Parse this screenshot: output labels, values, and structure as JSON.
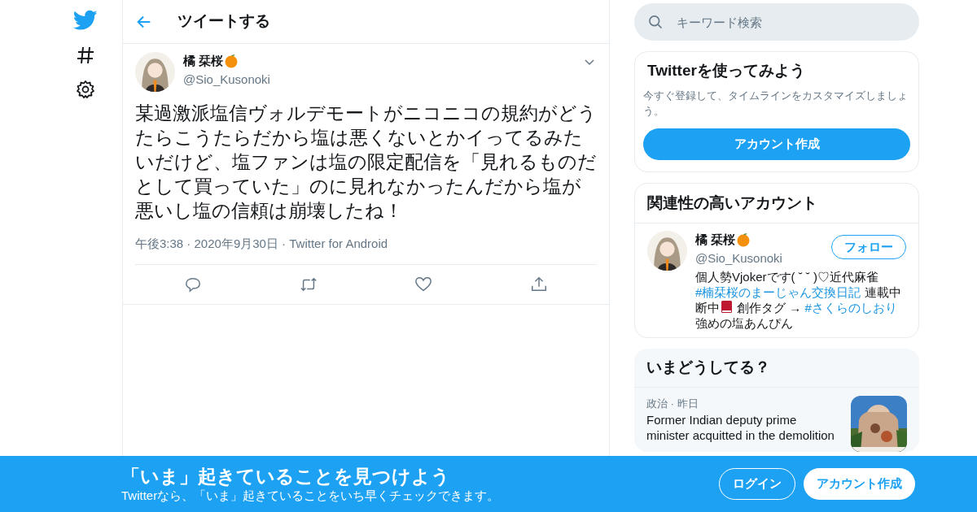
{
  "header": {
    "title": "ツイートする"
  },
  "tweet": {
    "name": "橘 栞桜",
    "handle": "@Sio_Kusonoki",
    "text": "某過激派塩信ヴォルデモートがニコニコの規約がどうたらこうたらだから塩は悪くないとかイってるみたいだけど、塩ファンは塩の限定配信を「見れるものだとして買っていた」のに見れなかったんだから塩が悪いし塩の信頼は崩壊したね！",
    "meta": "午後3:38 · 2020年9月30日 · Twitter for Android"
  },
  "search": {
    "placeholder": "キーワード検索"
  },
  "signup_card": {
    "title": "Twitterを使ってみよう",
    "text": "今すぐ登録して、タイムラインをカスタマイズしましょう。",
    "button": "アカウント作成"
  },
  "related": {
    "title": "関連性の高いアカウント",
    "accounts": [
      {
        "name": "橘 栞桜",
        "handle": "@Sio_Kusonoki",
        "follow": "フォロー",
        "bio": [
          {
            "kind": "text",
            "text": "個人勢Vjokerです( ˘ ˘ )♡近代麻雀 "
          },
          {
            "kind": "hashtag",
            "text": "#楠栞桜のまーじゃん交換日記"
          },
          {
            "kind": "text",
            "text": " 連載中断中"
          },
          {
            "kind": "book"
          },
          {
            "kind": "text",
            "text": " 創作タグ → "
          },
          {
            "kind": "hashtag",
            "text": "#さくらのしおり"
          },
          {
            "kind": "text",
            "text": " 強めの塩あんぴん"
          }
        ]
      }
    ]
  },
  "trends": {
    "title": "いまどうしてる？",
    "items": [
      {
        "meta": "政治 · 昨日",
        "text": "Former Indian deputy prime minister acquitted in the demolition",
        "kind": "picture"
      }
    ]
  },
  "bottom_bar": {
    "title": "「いま」起きていることを見つけよう",
    "subtitle": "Twitterなら、「いま」起きていることをいち早くチェックできます。",
    "login": "ログイン",
    "signup": "アカウント作成"
  }
}
